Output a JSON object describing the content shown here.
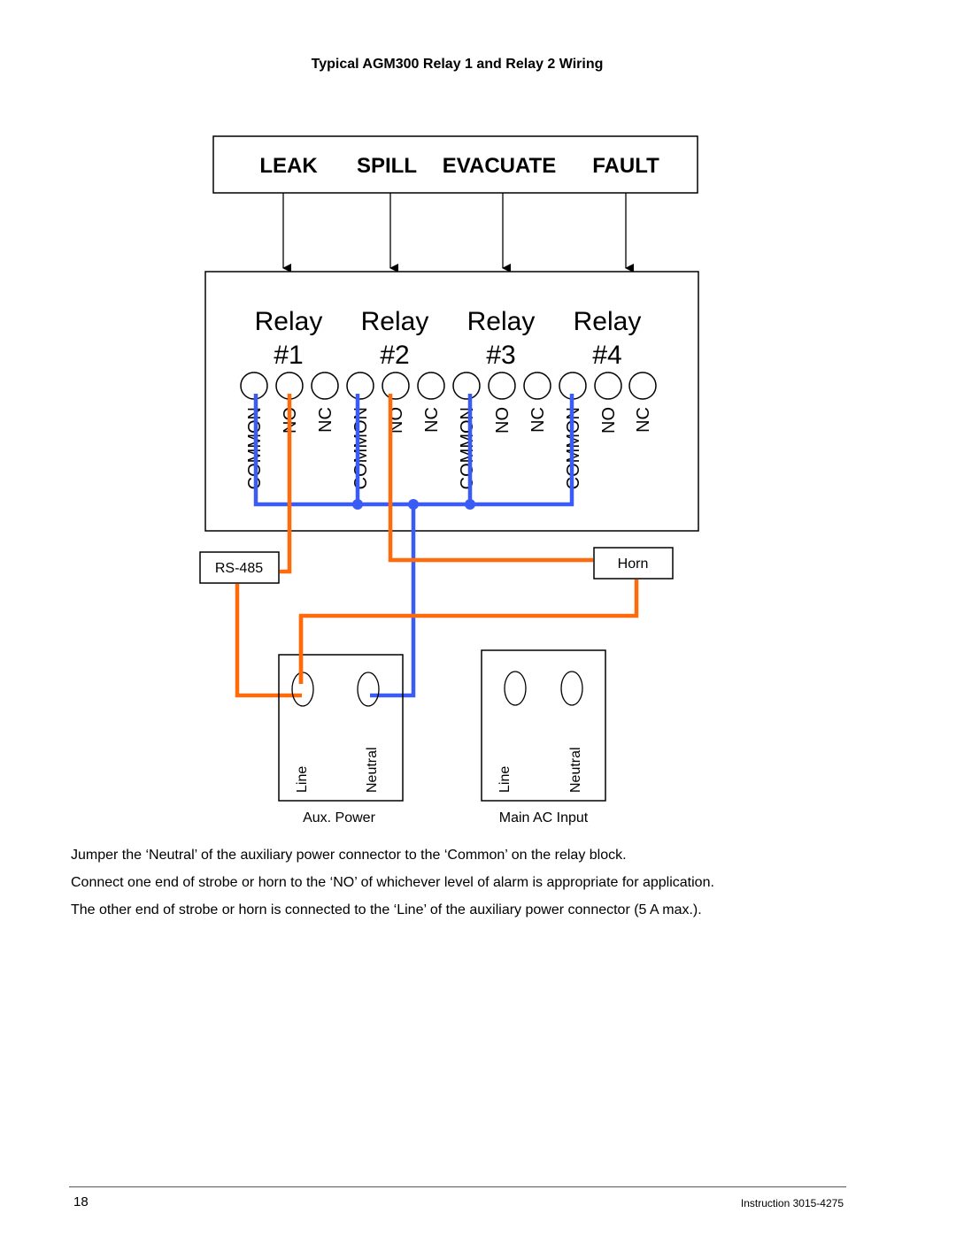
{
  "title": "Typical AGM300 Relay 1 and Relay 2 Wiring",
  "alarm_levels": [
    "LEAK",
    "SPILL",
    "EVACUATE",
    "FAULT"
  ],
  "relays": [
    {
      "label": "Relay",
      "number": "#1"
    },
    {
      "label": "Relay",
      "number": "#2"
    },
    {
      "label": "Relay",
      "number": "#3"
    },
    {
      "label": "Relay",
      "number": "#4"
    }
  ],
  "terminal_labels": [
    "COMMON",
    "NO",
    "NC"
  ],
  "devices": {
    "rs485": "RS-485",
    "horn": "Horn",
    "aux_power": {
      "caption": "Aux. Power",
      "line": "Line",
      "neutral": "Neutral"
    },
    "main_ac": {
      "caption": "Main AC Input",
      "line": "Line",
      "neutral": "Neutral"
    }
  },
  "wire_colors": {
    "common": "#3a5cf5",
    "signal": "#ff6a0a"
  },
  "notes": [
    "Jumper the ‘Neutral’ of the auxiliary power connector to the ‘Common’ on the relay block.",
    "Connect one end of strobe or horn to the ‘NO’ of whichever level of alarm is appropriate for application.",
    "The other end of strobe or horn is connected to the ‘Line’ of the auxiliary power connector (5 A max.)."
  ],
  "footer": {
    "page_number": "18",
    "document": "Instruction 3015-4275"
  }
}
